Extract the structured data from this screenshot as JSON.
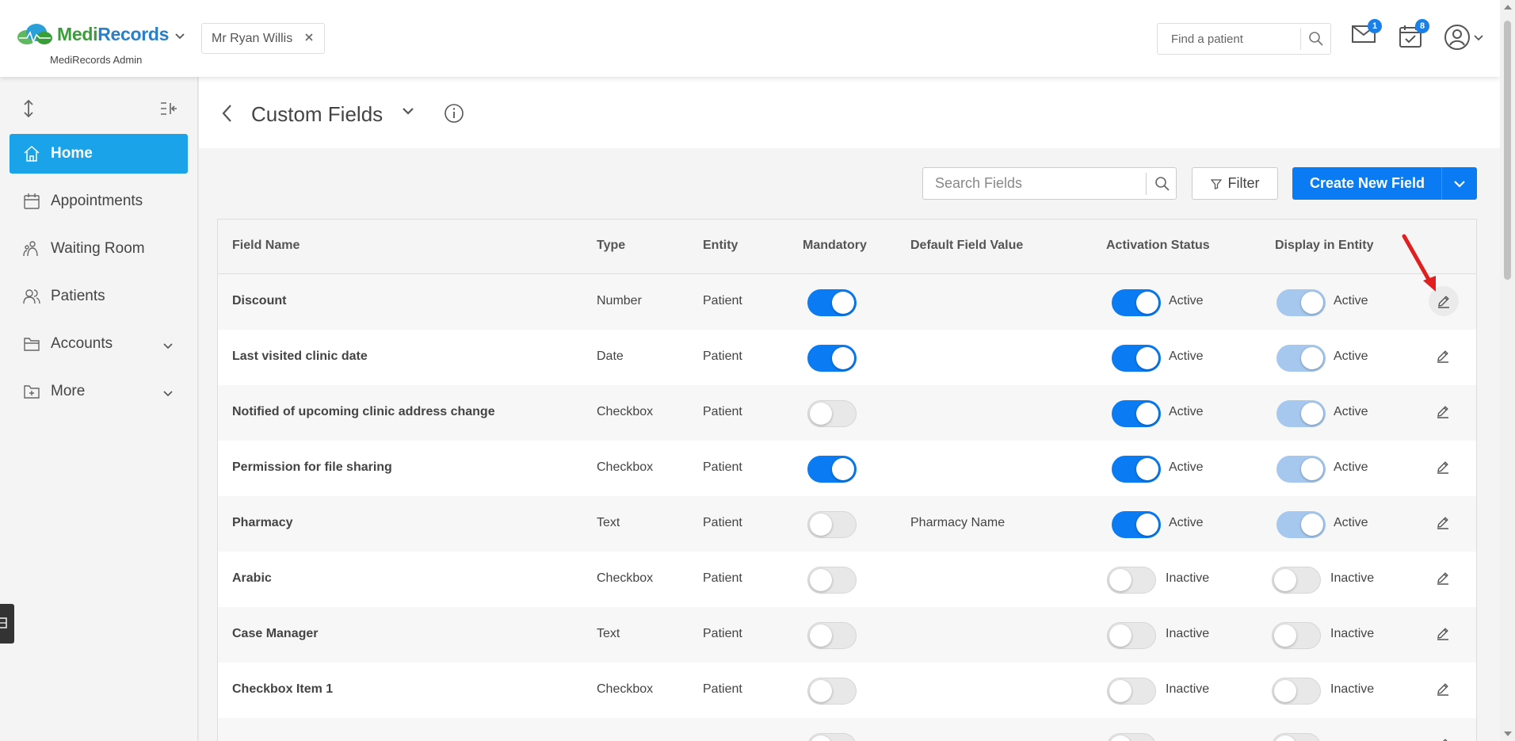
{
  "header": {
    "logo_medi": "Medi",
    "logo_records": "Records",
    "admin_label": "MediRecords Admin",
    "patient_chip": "Mr Ryan Willis",
    "find_patient_placeholder": "Find a patient",
    "mail_count": "1",
    "calendar_count": "8"
  },
  "sidebar": {
    "items": [
      {
        "label": "Home",
        "active": true
      },
      {
        "label": "Appointments"
      },
      {
        "label": "Waiting Room"
      },
      {
        "label": "Patients"
      },
      {
        "label": "Accounts",
        "expandable": true
      },
      {
        "label": "More",
        "expandable": true
      }
    ]
  },
  "page": {
    "title": "Custom Fields",
    "search_placeholder": "Search Fields",
    "filter_label": "Filter",
    "create_label": "Create New Field"
  },
  "table": {
    "columns": [
      "Field Name",
      "Type",
      "Entity",
      "Mandatory",
      "Default Field Value",
      "Activation Status",
      "Display in Entity"
    ],
    "rows": [
      {
        "name": "Discount",
        "type": "Number",
        "entity": "Patient",
        "mandatory": true,
        "default": "",
        "activation": "Active",
        "display": "Active"
      },
      {
        "name": "Last visited clinic date",
        "type": "Date",
        "entity": "Patient",
        "mandatory": true,
        "default": "",
        "activation": "Active",
        "display": "Active"
      },
      {
        "name": "Notified of upcoming clinic address change",
        "type": "Checkbox",
        "entity": "Patient",
        "mandatory": false,
        "default": "",
        "activation": "Active",
        "display": "Active"
      },
      {
        "name": "Permission for file sharing",
        "type": "Checkbox",
        "entity": "Patient",
        "mandatory": true,
        "default": "",
        "activation": "Active",
        "display": "Active"
      },
      {
        "name": "Pharmacy",
        "type": "Text",
        "entity": "Patient",
        "mandatory": false,
        "default": "Pharmacy Name",
        "activation": "Active",
        "display": "Active"
      },
      {
        "name": "Arabic",
        "type": "Checkbox",
        "entity": "Patient",
        "mandatory": false,
        "default": "",
        "activation": "Inactive",
        "display": "Inactive"
      },
      {
        "name": "Case Manager",
        "type": "Text",
        "entity": "Patient",
        "mandatory": false,
        "default": "",
        "activation": "Inactive",
        "display": "Inactive"
      },
      {
        "name": "Checkbox Item 1",
        "type": "Checkbox",
        "entity": "Patient",
        "mandatory": false,
        "default": "",
        "activation": "Inactive",
        "display": "Inactive"
      },
      {
        "name": "",
        "type": "",
        "entity": "",
        "mandatory": false,
        "default": "",
        "activation": "",
        "display": ""
      }
    ]
  },
  "colors": {
    "primary": "#0a7bf2",
    "sidebar_active": "#1aa3e8",
    "toggle_disabled_on": "#a6c8ee",
    "annotation_arrow": "#e02020"
  }
}
